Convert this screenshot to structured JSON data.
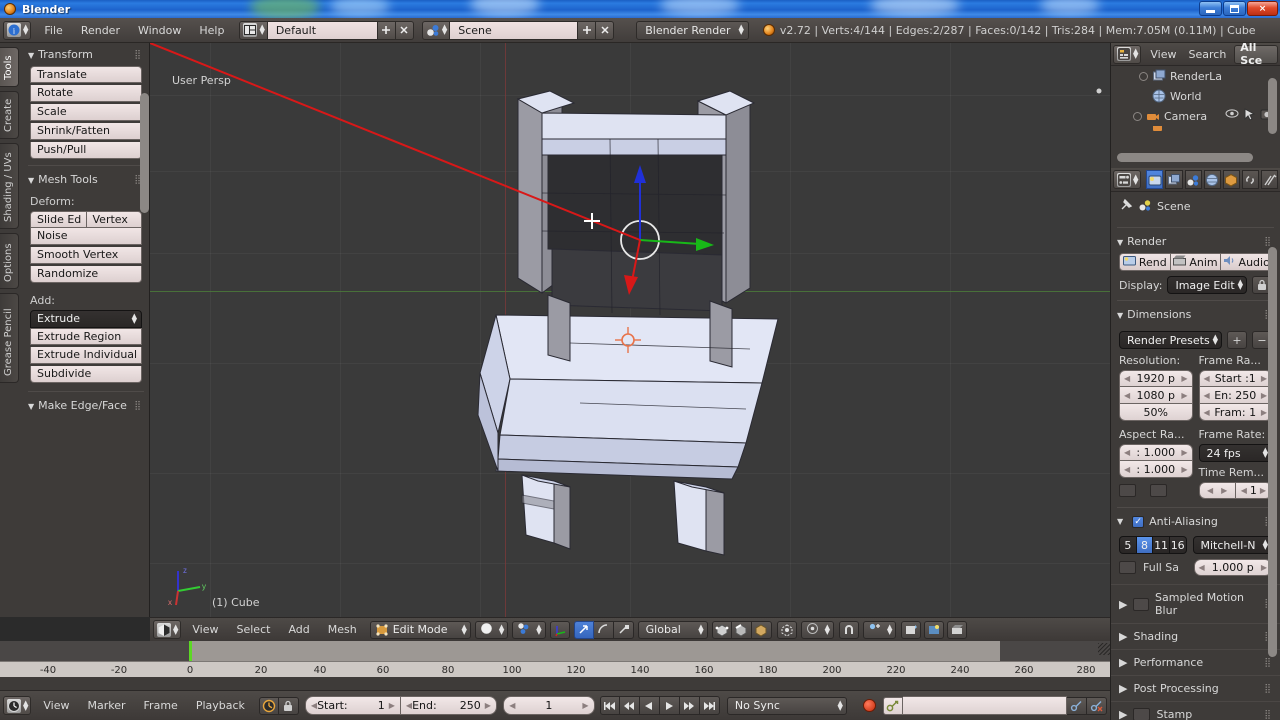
{
  "window": {
    "title": "Blender",
    "app_icon": "blender-logo-icon",
    "minimize": "minimize-icon",
    "maximize": "maximize-icon",
    "close": "×"
  },
  "topbar": {
    "editor_type_icon": "info-editor-icon",
    "menus": [
      "File",
      "Render",
      "Window",
      "Help"
    ],
    "layout_icon": "screen-layout-icon",
    "layout_value": "Default",
    "layout_add": "+",
    "layout_remove": "✕",
    "scene_icon": "scene-data-icon",
    "scene_value": "Scene",
    "scene_add": "+",
    "scene_remove": "✕",
    "engine_value": "Blender Render",
    "status": "v2.72 | Verts:4/144 | Edges:2/287 | Faces:0/142 | Tris:284 | Mem:7.05M (0.11M) | Cube",
    "status_icon": "blender-logo-icon"
  },
  "toolshelf": {
    "tabs": [
      {
        "label": "Tools",
        "active": true
      },
      {
        "label": "Create",
        "active": false
      },
      {
        "label": "Shading / UVs",
        "active": false
      },
      {
        "label": "Options",
        "active": false
      },
      {
        "label": "Grease Pencil",
        "active": false
      }
    ],
    "transform": {
      "title": "Transform",
      "buttons": [
        "Translate",
        "Rotate",
        "Scale",
        "Shrink/Fatten",
        "Push/Pull"
      ]
    },
    "mesh_tools": {
      "title": "Mesh Tools",
      "deform_label": "Deform:",
      "deform_row": [
        "Slide Ed",
        "Vertex"
      ],
      "deform_buttons": [
        "Noise",
        "Smooth Vertex",
        "Randomize"
      ],
      "add_label": "Add:",
      "add_dropdown": "Extrude",
      "add_buttons": [
        "Extrude Region",
        "Extrude Individual",
        "Subdivide"
      ]
    },
    "make_edge_face": {
      "title": "Make Edge/Face"
    }
  },
  "viewport": {
    "persp_label": "User Persp",
    "object_label": "(1) Cube",
    "axis_x": "x",
    "axis_y": "y",
    "axis_z": "z",
    "manipulator_icon": "transform-manipulator-icon",
    "cursor_icon": "3d-cursor-icon",
    "crosshair_icon": "mouse-crosshair-icon",
    "header": {
      "editor_icon": "3d-view-editor-icon",
      "menus": [
        "View",
        "Select",
        "Add",
        "Mesh"
      ],
      "mode_icon": "edit-mode-icon",
      "mode_value": "Edit Mode",
      "shading_icon": "solid-shading-icon",
      "pivot_icon": "pivot-median-icon",
      "manip_axis_icon": "manipulator-axis-icon",
      "manip_translate_icon": "translate-manipulator-icon",
      "manip_rotate_icon": "rotate-manipulator-icon",
      "manip_scale_icon": "scale-manipulator-icon",
      "orientation_value": "Global",
      "select_vertex_icon": "vertex-select-icon",
      "select_edge_icon": "edge-select-icon",
      "select_face_icon": "face-select-icon",
      "occlude_icon": "limit-selection-visible-icon",
      "proportional_icon": "proportional-edit-icon",
      "snap_magnet_icon": "snap-magnet-icon",
      "snap_target_icon": "snap-target-icon",
      "render_only_icon": "render-only-icon",
      "view_render_icon": "viewport-render-icon",
      "view_render_anim_icon": "viewport-render-anim-icon"
    }
  },
  "outliner": {
    "editor_icon": "outliner-editor-icon",
    "menus": [
      "View",
      "Search"
    ],
    "display_mode": "All Sce",
    "rows": [
      {
        "label": "RenderLa",
        "icon": "render-layers-icon",
        "expandable": true,
        "tools": []
      },
      {
        "label": "World",
        "icon": "world-icon",
        "expandable": false,
        "tools": []
      },
      {
        "label": "Camera",
        "icon": "camera-data-icon",
        "expandable": true,
        "tools": [
          "eye-icon",
          "cursor-arrow-icon",
          "render-restrict-icon"
        ]
      }
    ]
  },
  "properties": {
    "editor_icon": "properties-editor-icon",
    "tabs": [
      {
        "icon": "render-tab-icon",
        "active": true
      },
      {
        "icon": "render-layers-tab-icon",
        "active": false
      },
      {
        "icon": "scene-tab-icon",
        "active": false
      },
      {
        "icon": "world-tab-icon",
        "active": false
      },
      {
        "icon": "object-tab-icon",
        "active": false
      },
      {
        "icon": "constraints-tab-icon",
        "active": false
      },
      {
        "icon": "modifiers-tab-icon",
        "active": false
      }
    ],
    "breadcrumb": {
      "pin_icon": "pin-icon",
      "scene_icon": "scene-data-icon",
      "label": "Scene"
    },
    "render": {
      "title": "Render",
      "buttons": [
        {
          "label": "Rend",
          "icon": "render-image-icon"
        },
        {
          "label": "Anim",
          "icon": "render-animation-icon"
        },
        {
          "label": "Audio",
          "icon": "render-audio-icon"
        }
      ],
      "display_label": "Display:",
      "display_value": "Image Edit",
      "display_lock_icon": "lock-icon"
    },
    "dimensions": {
      "title": "Dimensions",
      "presets_value": "Render Presets",
      "presets_add": "+",
      "presets_remove": "−",
      "resolution_label": "Resolution:",
      "resolution_x": "1920 p",
      "resolution_y": "1080 p",
      "resolution_percent": "50%",
      "frame_range_label": "Frame Ra...",
      "frame_start": "Start :1",
      "frame_end": "En: 250",
      "frame_step": "Fram: 1",
      "aspect_label": "Aspect Ra...",
      "aspect_x": ": 1.000",
      "aspect_y": ": 1.000",
      "border_swatch": "border-toggle",
      "crop_swatch": "crop-toggle",
      "frame_rate_label": "Frame Rate:",
      "frame_rate_value": "24 fps",
      "time_remap_label": "Time Rem...",
      "time_remap_old": "",
      "time_remap_new": "1"
    },
    "anti_aliasing": {
      "title": "Anti-Aliasing",
      "enabled": true,
      "samples": [
        "5",
        "8",
        "11",
        "16"
      ],
      "samples_active": "8",
      "filter_value": "Mitchell-N",
      "full_sample_label": "Full Sa",
      "filter_size": "1.000 p"
    },
    "collapsed_panels": [
      {
        "title": "Sampled Motion Blur",
        "has_toggle": true
      },
      {
        "title": "Shading",
        "has_toggle": false
      },
      {
        "title": "Performance",
        "has_toggle": false
      },
      {
        "title": "Post Processing",
        "has_toggle": false
      },
      {
        "title": "Stamp",
        "has_toggle": true
      }
    ]
  },
  "timeline": {
    "editor_icon": "timeline-editor-icon",
    "menus": [
      "View",
      "Marker",
      "Frame",
      "Playback"
    ],
    "use_keying_icon": "keying-set-icon",
    "lock_icon": "lock-icon",
    "start_label": "Start:",
    "start_value": "1",
    "end_label": "End:",
    "end_value": "250",
    "current_frame": "1",
    "playback_icons": [
      "jump-start-icon",
      "frame-back-icon",
      "play-reverse-icon",
      "play-icon",
      "frame-forward-icon",
      "jump-end-icon"
    ],
    "sync_value": "No Sync",
    "record_icon": "auto-keyframe-icon",
    "keying_set_icon": "keying-set-icon",
    "keyframe_add_icon": "insert-keyframe-icon",
    "keyframe_del_icon": "delete-keyframe-icon",
    "ruler": {
      "ticks": [
        -40,
        -20,
        0,
        20,
        40,
        60,
        80,
        100,
        120,
        140,
        160,
        180,
        200,
        220,
        240,
        260,
        280
      ],
      "min": -48,
      "max": 288,
      "playhead": 0,
      "range_start": 1,
      "range_end": 250
    }
  },
  "colors": {
    "accent_blue": "#4f82d8",
    "playhead_green": "#5dd825",
    "panel_bg": "#3e3b39",
    "header_bg": "#4e4a47",
    "viewport_bg": "#3a3a3a",
    "field_light": "#e9dede",
    "axis_x_red": "#cc3333",
    "axis_y_green": "#33cc33",
    "axis_z_blue": "#3333cc",
    "mesh_light": "#dfe3f2",
    "mesh_dark": "#8b8b93"
  }
}
